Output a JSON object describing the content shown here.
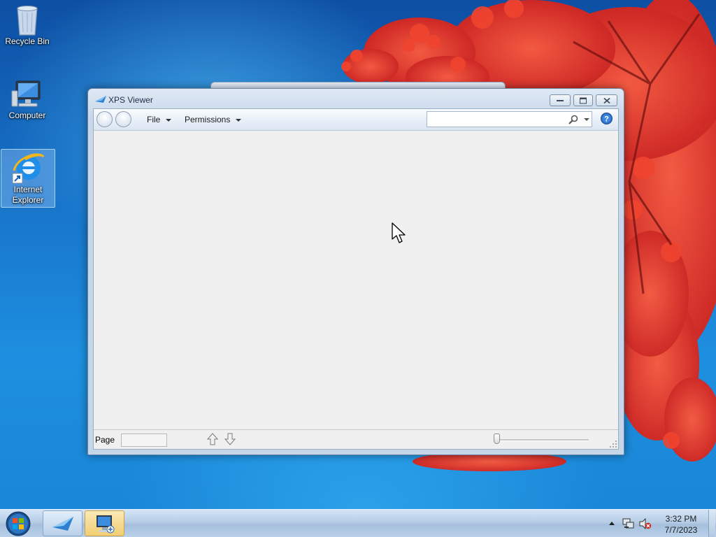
{
  "desktop": {
    "icons": [
      {
        "label": "Recycle Bin",
        "icon": "recycle-bin-icon"
      },
      {
        "label": "Computer",
        "icon": "computer-icon"
      },
      {
        "label": "Internet Explorer",
        "icon": "internet-explorer-icon",
        "selected": true
      }
    ]
  },
  "window": {
    "title": "XPS Viewer",
    "menus": [
      {
        "label": "File"
      },
      {
        "label": "Permissions"
      }
    ],
    "search": {
      "value": "",
      "placeholder": ""
    },
    "status": {
      "page_label": "Page",
      "page_value": ""
    }
  },
  "taskbar": {
    "apps": [
      "xps-viewer-icon",
      "remote-desktop-icon"
    ],
    "clock": {
      "time": "3:32 PM",
      "date": "7/7/2023"
    }
  },
  "colors": {
    "desktop_blue": "#1670c6",
    "coral_red": "#e8352a",
    "window_frame": "#c8d8ea",
    "client_bg": "#f0f0f0"
  }
}
